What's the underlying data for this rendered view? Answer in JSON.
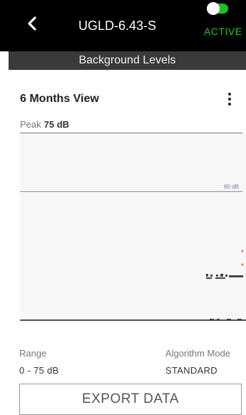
{
  "header": {
    "device_name": "UGLD-6.43-S",
    "status_label": "ACTIVE",
    "toggle_on": true,
    "subtitle": "Background Levels"
  },
  "view": {
    "title": "6 Months View",
    "peak_label": "Peak",
    "peak_value": "75 dB"
  },
  "chart_data": {
    "type": "scatter",
    "ylim": [
      0,
      75
    ],
    "threshold": {
      "value": 60,
      "label": "60 dB",
      "color": "#e86a4f"
    },
    "series_color": "#444444",
    "grid": false
  },
  "footer": {
    "range_label": "Range",
    "range_value": "0 - 75 dB",
    "algorithm_label": "Algorithm Mode",
    "algorithm_value": "STANDARD",
    "export_label": "EXPORT DATA"
  },
  "colors": {
    "active_green": "#1fc32b",
    "header_bg": "#000000",
    "subheader_bg": "#3a3a3a",
    "chart_bg": "#f7f7f7"
  },
  "icons": {
    "back": "chevron-left-icon",
    "menu": "kebab-menu-icon"
  }
}
